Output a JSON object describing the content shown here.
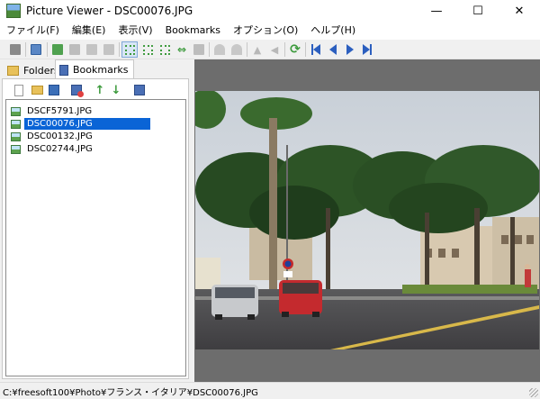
{
  "window": {
    "title": "Picture Viewer - DSC00076.JPG",
    "minimize": "—",
    "maximize": "☐",
    "close": "✕"
  },
  "menu": [
    "ファイル(F)",
    "編集(E)",
    "表示(V)",
    "Bookmarks",
    "オプション(O)",
    "ヘルプ(H)"
  ],
  "tabs": {
    "folders": "Folders",
    "bookmarks": "Bookmarks"
  },
  "bookmarks": {
    "items": [
      "DSCF5791.JPG",
      "DSC00076.JPG",
      "DSC00132.JPG",
      "DSC02744.JPG"
    ],
    "selected": "DSC00076.JPG"
  },
  "status": {
    "path": "C:¥freesoft100¥Photo¥フランス・イタリア¥DSC00076.JPG"
  },
  "colors": {
    "selection": "#0a64d6",
    "viewer_bg": "#6d6d6d",
    "nav_blue": "#2c5fbf",
    "toolbar_green": "#3c9a3c"
  },
  "icons": {
    "toolbar": [
      "print-icon",
      "thumbnail-view-icon",
      "copy-icon",
      "paste-icon",
      "move-icon",
      "delete-icon",
      "fit-window-icon",
      "fit-width-icon",
      "fit-height-icon",
      "actual-size-icon",
      "stretch-horizontal-icon",
      "fullscreen-icon",
      "rotate-left-icon",
      "rotate-right-icon",
      "flip-vertical-icon",
      "flip-horizontal-icon",
      "refresh-icon",
      "first-image-icon",
      "previous-image-icon",
      "next-image-icon",
      "last-image-icon"
    ],
    "bookmarks_toolbar": [
      "new-list-icon",
      "open-folder-icon",
      "save-icon",
      "delete-bookmark-icon",
      "move-up-icon",
      "move-down-icon",
      "bookmark-settings-icon"
    ]
  }
}
